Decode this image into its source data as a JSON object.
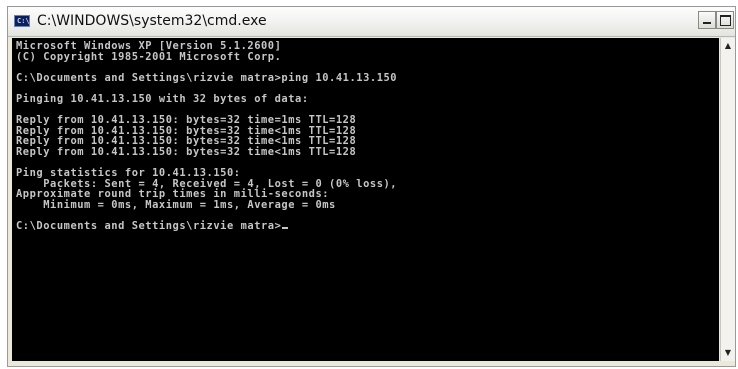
{
  "window": {
    "title": "C:\\WINDOWS\\system32\\cmd.exe",
    "icon": "cmd-icon"
  },
  "console": {
    "lines": [
      "Microsoft Windows XP [Version 5.1.2600]",
      "(C) Copyright 1985-2001 Microsoft Corp.",
      "",
      "C:\\Documents and Settings\\rizvie matra>ping 10.41.13.150",
      "",
      "Pinging 10.41.13.150 with 32 bytes of data:",
      "",
      "Reply from 10.41.13.150: bytes=32 time=1ms TTL=128",
      "Reply from 10.41.13.150: bytes=32 time<1ms TTL=128",
      "Reply from 10.41.13.150: bytes=32 time<1ms TTL=128",
      "Reply from 10.41.13.150: bytes=32 time<1ms TTL=128",
      "",
      "Ping statistics for 10.41.13.150:",
      "    Packets: Sent = 4, Received = 4, Lost = 0 (0% loss),",
      "Approximate round trip times in milli-seconds:",
      "    Minimum = 0ms, Maximum = 1ms, Average = 0ms",
      "",
      "C:\\Documents and Settings\\rizvie matra>"
    ],
    "text_color": "#c6c6c6",
    "background": "#000000"
  },
  "controls": {
    "minimize_icon": "minimize-icon",
    "maximize_icon": "maximize-icon",
    "scroll_up_icon": "scroll-up-arrow-icon",
    "scroll_down_icon": "scroll-down-arrow-icon"
  }
}
